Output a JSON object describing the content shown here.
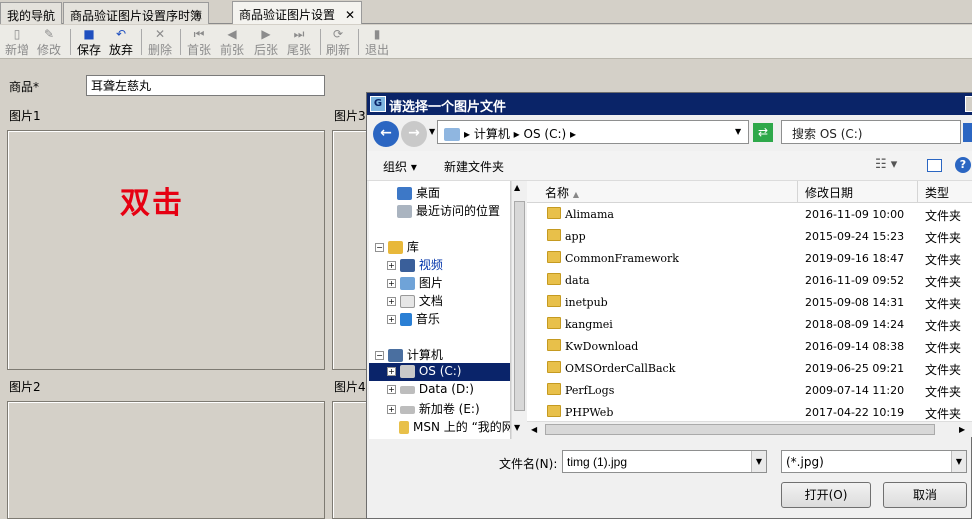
{
  "tabs": [
    {
      "label": "我的导航"
    },
    {
      "label": "商品验证图片设置序时簿"
    },
    {
      "label": "商品验证图片设置",
      "close": "✕"
    }
  ],
  "toolbar": {
    "new": "新增",
    "edit": "修改",
    "save": "保存",
    "discard": "放弃",
    "delete": "删除",
    "first": "首张",
    "prev": "前张",
    "next": "后张",
    "last": "尾张",
    "refresh": "刷新",
    "exit": "退出"
  },
  "form": {
    "goods_label": "商品*",
    "goods_value": "耳聋左慈丸",
    "img1": "图片1",
    "img2": "图片2",
    "img3": "图片3",
    "img4": "图片4",
    "hint": "双击"
  },
  "dialog": {
    "title": "请选择一个图片文件",
    "address": {
      "computer": "计算机",
      "drive": "OS (C:)"
    },
    "search_placeholder": "搜索 OS (C:)",
    "organize": "组织",
    "new_folder": "新建文件夹",
    "tree": {
      "desktop": "桌面",
      "recent": "最近访问的位置",
      "library": "库",
      "videos": "视频",
      "pictures": "图片",
      "documents": "文档",
      "music": "音乐",
      "computer": "计算机",
      "os_c": "OS (C:)",
      "data_d": "Data (D:)",
      "new_e": "新加卷 (E:)",
      "msn": "MSN 上的 “我的网"
    },
    "columns": {
      "name": "名称",
      "date": "修改日期",
      "type": "类型"
    },
    "files": [
      {
        "name": "Alimama",
        "date": "2016-11-09 10:00",
        "type": "文件夹"
      },
      {
        "name": "app",
        "date": "2015-09-24 15:23",
        "type": "文件夹"
      },
      {
        "name": "CommonFramework",
        "date": "2019-09-16 18:47",
        "type": "文件夹"
      },
      {
        "name": "data",
        "date": "2016-11-09 09:52",
        "type": "文件夹"
      },
      {
        "name": "inetpub",
        "date": "2015-09-08 14:31",
        "type": "文件夹"
      },
      {
        "name": "kangmei",
        "date": "2018-08-09 14:24",
        "type": "文件夹"
      },
      {
        "name": "KwDownload",
        "date": "2016-09-14 08:38",
        "type": "文件夹"
      },
      {
        "name": "OMSOrderCallBack",
        "date": "2019-06-25 09:21",
        "type": "文件夹"
      },
      {
        "name": "PerfLogs",
        "date": "2009-07-14 11:20",
        "type": "文件夹"
      },
      {
        "name": "PHPWeb",
        "date": "2017-04-22 10:19",
        "type": "文件夹"
      }
    ],
    "filename_label": "文件名(N):",
    "filename_value": "timg (1).jpg",
    "filter_value": "(*.jpg)",
    "open": "打开(O)",
    "cancel": "取消"
  }
}
